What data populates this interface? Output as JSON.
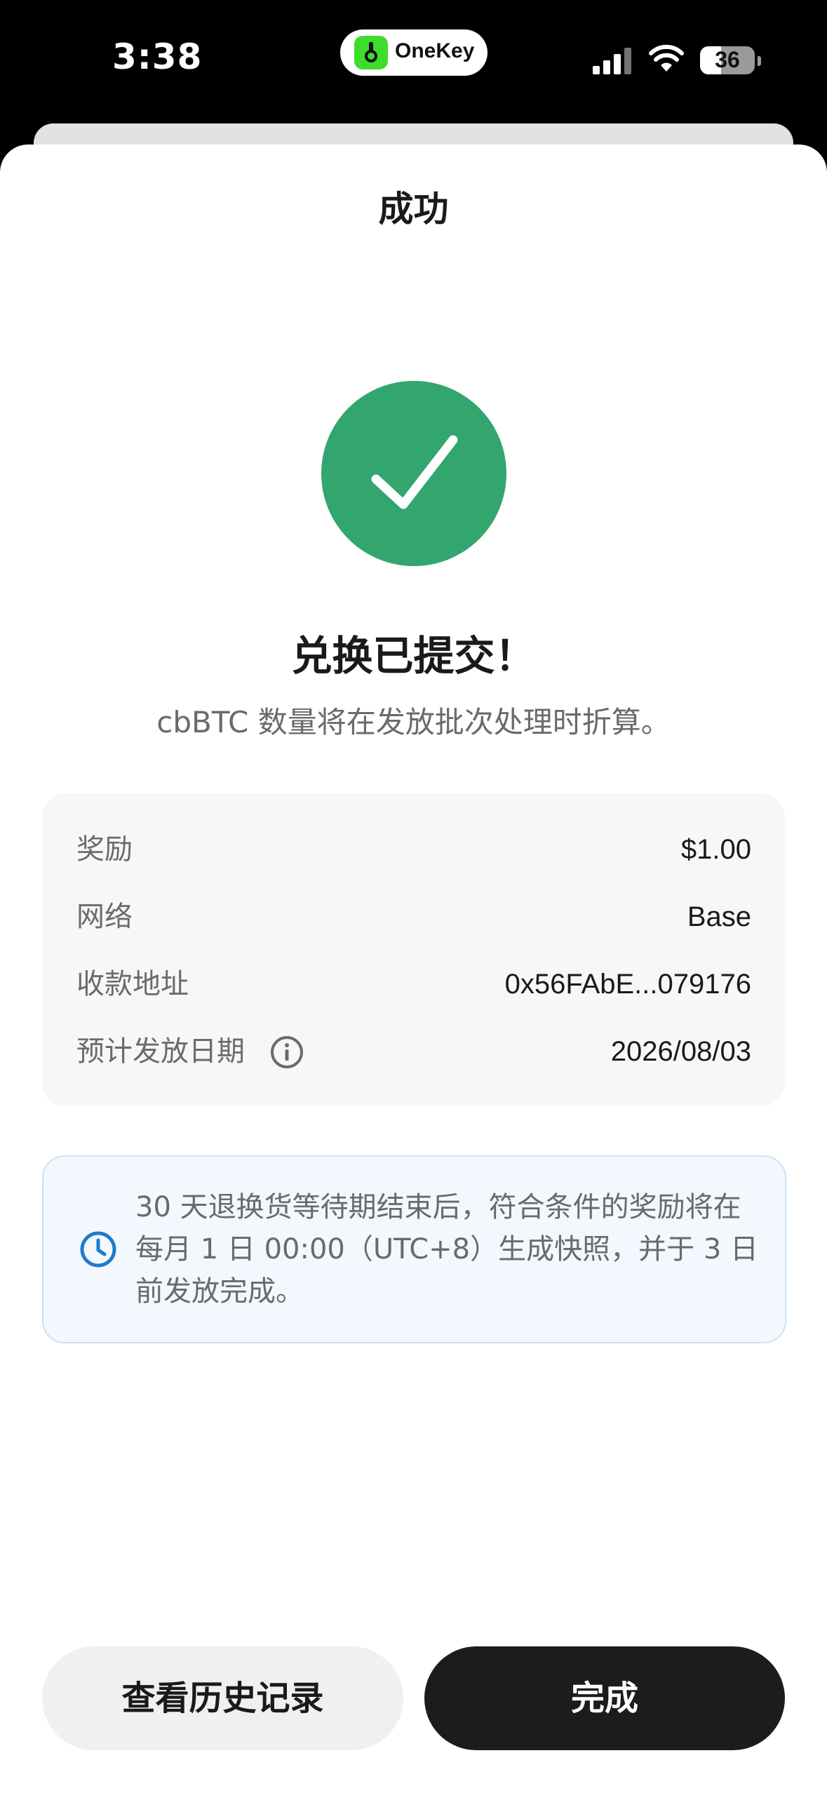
{
  "status_bar": {
    "time": "3:38",
    "island_app": "OneKey",
    "battery": "36"
  },
  "sheet": {
    "title": "成功",
    "headline": "兑换已提交！",
    "subline": "cbBTC 数量将在发放批次处理时折算。",
    "details": [
      {
        "label": "奖励",
        "value": "$1.00"
      },
      {
        "label": "网络",
        "value": "Base"
      },
      {
        "label": "收款地址",
        "value": "0x56FAbE...079176"
      },
      {
        "label": "预计发放日期",
        "value": "2026/08/03"
      }
    ],
    "notice": "30 天退换货等待期结束后，符合条件的奖励将在每月 1 日 00:00（UTC+8）生成快照，并于 3 日前发放完成。"
  },
  "buttons": {
    "history": "查看历史记录",
    "done": "完成"
  },
  "colors": {
    "success_green": "#33a56f",
    "notice_blue": "#1f7acc",
    "primary_button": "#1c1c1c"
  }
}
